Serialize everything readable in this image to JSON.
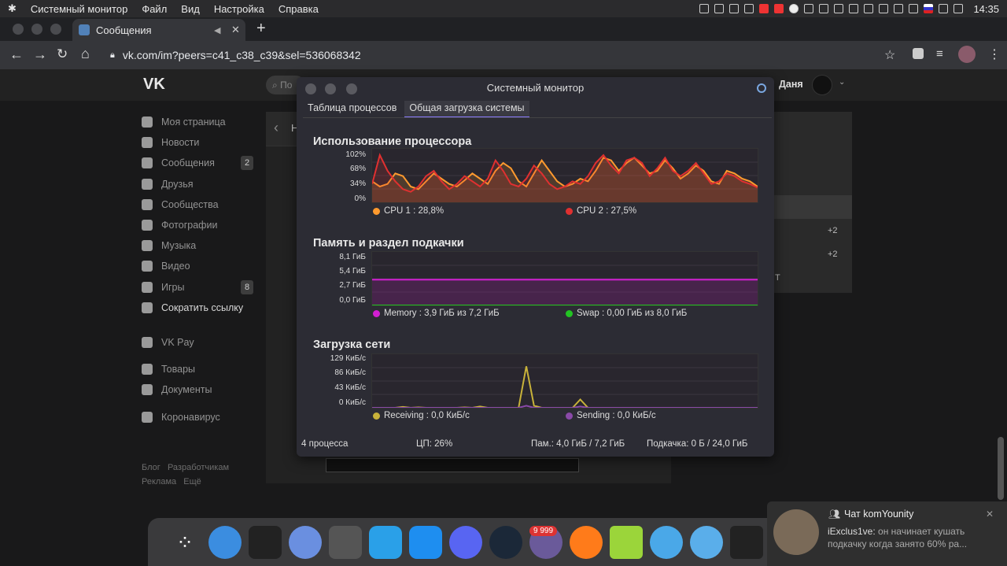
{
  "menubar": {
    "app": "Системный монитор",
    "file": "Файл",
    "view": "Вид",
    "settings": "Настройка",
    "help": "Справка",
    "time": "14:35"
  },
  "browser": {
    "tab_title": "Сообщения",
    "url": "vk.com/im?peers=c41_c38_c39&sel=536068342"
  },
  "vk": {
    "search_placeholder": "По",
    "user": "Даня",
    "back_label": "Н"
  },
  "sidebar": {
    "items": [
      {
        "label": "Моя страница"
      },
      {
        "label": "Новости"
      },
      {
        "label": "Сообщения",
        "badge": "2"
      },
      {
        "label": "Друзья"
      },
      {
        "label": "Сообщества"
      },
      {
        "label": "Фотографии"
      },
      {
        "label": "Музыка"
      },
      {
        "label": "Видео"
      },
      {
        "label": "Игры",
        "badge": "8"
      },
      {
        "label": "Сократить ссылку"
      },
      {
        "label": "VK Pay"
      },
      {
        "label": "Товары"
      },
      {
        "label": "Документы"
      },
      {
        "label": "Коронавирус"
      }
    ],
    "footer": {
      "blog": "Блог",
      "dev": "Разработчикам",
      "ads": "Реклама",
      "more": "Ещё"
    }
  },
  "rightpanel": {
    "plus1": "+2",
    "plus2": "+2",
    "t": "T"
  },
  "sysmon": {
    "title": "Системный монитор",
    "tabs": [
      "Таблица процессов",
      "Общая загрузка системы"
    ],
    "cpu": {
      "title": "Использование процессора",
      "ticks": [
        "102%",
        "68%",
        "34%",
        "0%"
      ],
      "legend": [
        "CPU 1 : 28,8%",
        "CPU 2 : 27,5%"
      ],
      "colors": [
        "#ff9a2e",
        "#e03030"
      ]
    },
    "mem": {
      "title": "Память и раздел подкачки",
      "ticks": [
        "8,1 ГиБ",
        "5,4 ГиБ",
        "2,7 ГиБ",
        "0,0 ГиБ"
      ],
      "legend": [
        "Memory : 3,9 ГиБ из 7,2 ГиБ",
        "Swap : 0,00 ГиБ из 8,0 ГиБ"
      ],
      "colors": [
        "#d21ed2",
        "#22c422"
      ]
    },
    "net": {
      "title": "Загрузка сети",
      "ticks": [
        "129 КиБ/с",
        "86 КиБ/с",
        "43 КиБ/с",
        "0 КиБ/с"
      ],
      "legend": [
        "Receiving : 0,0 КиБ/с",
        "Sending : 0,0 КиБ/с"
      ],
      "colors": [
        "#c8b23a",
        "#8a4aa8"
      ]
    },
    "status": {
      "procs": "4 процесса",
      "cpu": "ЦП: 26%",
      "mem": "Пам.: 4,0 ГиБ / 7,2 ГиБ",
      "swap": "Подкачка: 0 Б / 24,0 ГиБ"
    }
  },
  "dock": {
    "badge": "9 999"
  },
  "notification": {
    "title": "Чат komYounity",
    "author": "iExclus1ve:",
    "text": "он начинает кушать подкачку когда занято 60% ра..."
  },
  "chart_data": [
    {
      "type": "line",
      "title": "Использование процессора",
      "ylim": [
        0,
        102
      ],
      "series": [
        {
          "name": "CPU 1 : 28,8%",
          "values": [
            40,
            30,
            35,
            55,
            50,
            30,
            25,
            40,
            55,
            45,
            35,
            30,
            42,
            55,
            45,
            35,
            60,
            75,
            65,
            40,
            30,
            55,
            80,
            60,
            40,
            30,
            35,
            45,
            40,
            60,
            85,
            80,
            60,
            75,
            85,
            70,
            55,
            60,
            80,
            65,
            45,
            55,
            70,
            60,
            40,
            35,
            60,
            55,
            45,
            40,
            30
          ]
        },
        {
          "name": "CPU 2 : 27,5%",
          "values": [
            35,
            90,
            60,
            40,
            25,
            20,
            30,
            50,
            60,
            40,
            25,
            35,
            50,
            40,
            30,
            45,
            80,
            60,
            35,
            30,
            45,
            70,
            55,
            35,
            25,
            30,
            40,
            35,
            50,
            75,
            90,
            70,
            55,
            80,
            85,
            75,
            50,
            65,
            85,
            60,
            50,
            60,
            75,
            55,
            35,
            40,
            55,
            50,
            40,
            35,
            28
          ]
        }
      ]
    },
    {
      "type": "line",
      "title": "Память и раздел подкачки",
      "ylim": [
        0,
        8.1
      ],
      "series": [
        {
          "name": "Memory",
          "values": [
            3.9,
            3.9
          ]
        },
        {
          "name": "Swap",
          "values": [
            0,
            0
          ]
        }
      ]
    },
    {
      "type": "line",
      "title": "Загрузка сети",
      "ylim": [
        0,
        129
      ],
      "series": [
        {
          "name": "Receiving",
          "values": [
            0,
            0,
            0,
            0,
            2,
            0,
            1,
            0,
            0,
            0,
            0,
            0,
            1,
            0,
            3,
            0,
            0,
            0,
            0,
            0,
            100,
            5,
            0,
            0,
            0,
            0,
            0,
            20,
            0,
            0,
            0,
            0,
            0,
            0,
            0,
            0,
            0,
            0,
            0,
            0,
            0,
            0,
            0,
            0,
            0,
            0,
            0,
            0,
            0,
            0,
            0
          ]
        },
        {
          "name": "Sending",
          "values": [
            0,
            0,
            0,
            0,
            0,
            0,
            0,
            0,
            0,
            0,
            0,
            0,
            0,
            0,
            0,
            0,
            0,
            0,
            0,
            0,
            5,
            0,
            0,
            0,
            0,
            0,
            0,
            3,
            0,
            0,
            0,
            0,
            0,
            0,
            0,
            0,
            0,
            0,
            0,
            0,
            0,
            0,
            0,
            0,
            0,
            0,
            0,
            0,
            0,
            0,
            0
          ]
        }
      ]
    }
  ]
}
